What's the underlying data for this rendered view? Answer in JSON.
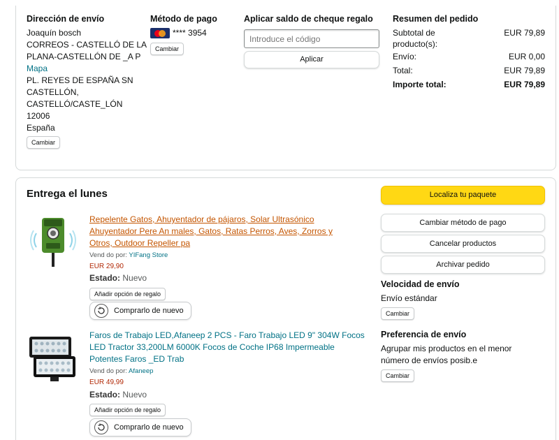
{
  "shipping": {
    "heading": "Dirección de envío",
    "name": "Joaquín bosch",
    "line1": "CORREOS - CASTELLÓ DE LA",
    "line2": "PLANA-CASTELLÓN DE _A P",
    "map_link": "Mapa",
    "line3": "PL. REYES DE ESPAÑA SN",
    "line4": "CASTELLÓN,",
    "line5": "CASTELLÓ/CASTE_LÓN",
    "postcode": "12006",
    "country": "España",
    "change_label": "Cambiar"
  },
  "payment": {
    "heading": "Método de pago",
    "card_brand": "mastercard",
    "card_number": "**** 3954",
    "change_label": "Cambiar"
  },
  "gift": {
    "heading": "Aplicar saldo de cheque regalo",
    "placeholder": "Introduce el código",
    "apply_label": "Aplicar"
  },
  "summary": {
    "heading": "Resumen del pedido",
    "subtotal_label_1": "Subtotal de",
    "subtotal_label_2": "producto(s):",
    "subtotal_value": "EUR 79,89",
    "shipping_label": "Envío:",
    "shipping_value": "EUR 0,00",
    "total_label": "Total:",
    "total_value": "EUR 79,89",
    "grand_total_label": "Importe total:",
    "grand_total_value": "EUR 79,89"
  },
  "delivery": {
    "heading": "Entrega el lunes",
    "items": [
      {
        "title_1": "Repelente Gatos, Ahuyentador de pájaros, Solar Ultrasónico",
        "title_2": "Ahuyentador Pere An males, Gatos, Ratas  Perros, Aves, Zorros y",
        "title_3": "Otros, Outdoor Repeller pa",
        "sold_by_label": "Vend do por:",
        "seller": "YIFang Store",
        "price": "EUR 29,90",
        "condition_label": "Estado:",
        "condition_value": "Nuevo",
        "gift_option": "Añadir opción de regalo",
        "buy_again": "Comprarlo de nuevo"
      },
      {
        "title_1": "Faros de Trabajo LED,Afaneep 2 PCS - Faro Trabajo LED 9\" 304W Focos",
        "title_2": "LED Tractor 33,200LM 6000K Focos de Coche IP68 Impermeable",
        "title_3": "Potentes Faros _ED Trab",
        "sold_by_label": "Vend do por:",
        "seller": "Afaneep",
        "price": "EUR 49,99",
        "condition_label": "Estado:",
        "condition_value": "Nuevo",
        "gift_option": "Añadir opción de regalo",
        "buy_again": "Comprarlo de nuevo"
      }
    ]
  },
  "actions": {
    "track": "Localiza tu paquete",
    "change_payment": "Cambiar método de pago",
    "cancel": "Cancelar productos",
    "archive": "Archivar pedido"
  },
  "speed": {
    "heading": "Velocidad de envío",
    "value": "Envío estándar",
    "change_label": "Cambiar"
  },
  "preference": {
    "heading": "Preferencia de envío",
    "value_1": "Agrupar mis productos en el menor",
    "value_2": "número de envíos posib.e",
    "change_label": "Cambiar"
  },
  "colors": {
    "accent_yellow": "#ffd814",
    "link_teal": "#007185",
    "link_orange": "#c45500",
    "price_red": "#b12704"
  }
}
